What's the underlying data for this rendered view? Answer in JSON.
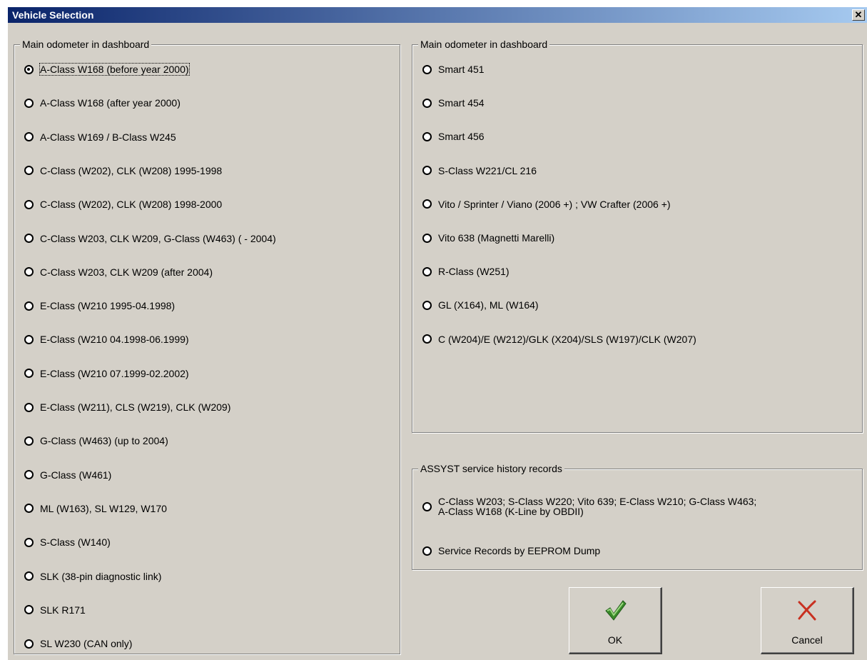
{
  "window": {
    "title": "Vehicle Selection"
  },
  "left_group": {
    "legend": "Main odometer in dashboard",
    "options": [
      "A-Class W168 (before year 2000)",
      "A-Class W168 (after year 2000)",
      "A-Class W169 / B-Class W245",
      "C-Class (W202), CLK (W208)  1995-1998",
      "C-Class (W202), CLK (W208)  1998-2000",
      "C-Class W203, CLK W209, G-Class (W463) ( - 2004)",
      "C-Class W203, CLK W209 (after 2004)",
      "E-Class (W210 1995-04.1998)",
      "E-Class (W210 04.1998-06.1999)",
      "E-Class (W210 07.1999-02.2002)",
      "E-Class (W211), CLS (W219), CLK (W209)",
      "G-Class (W463) (up to 2004)",
      "G-Class (W461)",
      "ML (W163), SL W129, W170",
      "S-Class (W140)",
      "SLK (38-pin diagnostic link)",
      "SLK R171",
      "SL W230 (CAN only)"
    ],
    "selected_index": 0
  },
  "right_group": {
    "legend": "Main odometer in dashboard",
    "options": [
      "Smart 451",
      "Smart 454",
      "Smart 456",
      "S-Class W221/CL 216",
      "Vito / Sprinter / Viano (2006 +) ; VW Crafter (2006 +)",
      "Vito 638 (Magnetti Marelli)",
      "R-Class (W251)",
      "GL (X164), ML (W164)",
      "C (W204)/E (W212)/GLK (X204)/SLS (W197)/CLK (W207)"
    ]
  },
  "assyst_group": {
    "legend": "ASSYST service history records",
    "option1_line1": "C-Class W203; S-Class W220; Vito 639; E-Class W210; G-Class W463;",
    "option1_line2": "A-Class W168 (K-Line by OBDII)",
    "option2": "Service Records by EEPROM Dump"
  },
  "buttons": {
    "ok": "OK",
    "cancel": "Cancel"
  },
  "icons": {
    "close": "close-icon",
    "ok": "checkmark-icon",
    "cancel": "x-cross-icon"
  },
  "colors": {
    "title_bar_start": "#0a246a",
    "title_bar_end": "#a6caf0",
    "ok_icon": "#3a8a2a",
    "cancel_icon": "#c83020",
    "dialog_face": "#d4d0c8"
  }
}
